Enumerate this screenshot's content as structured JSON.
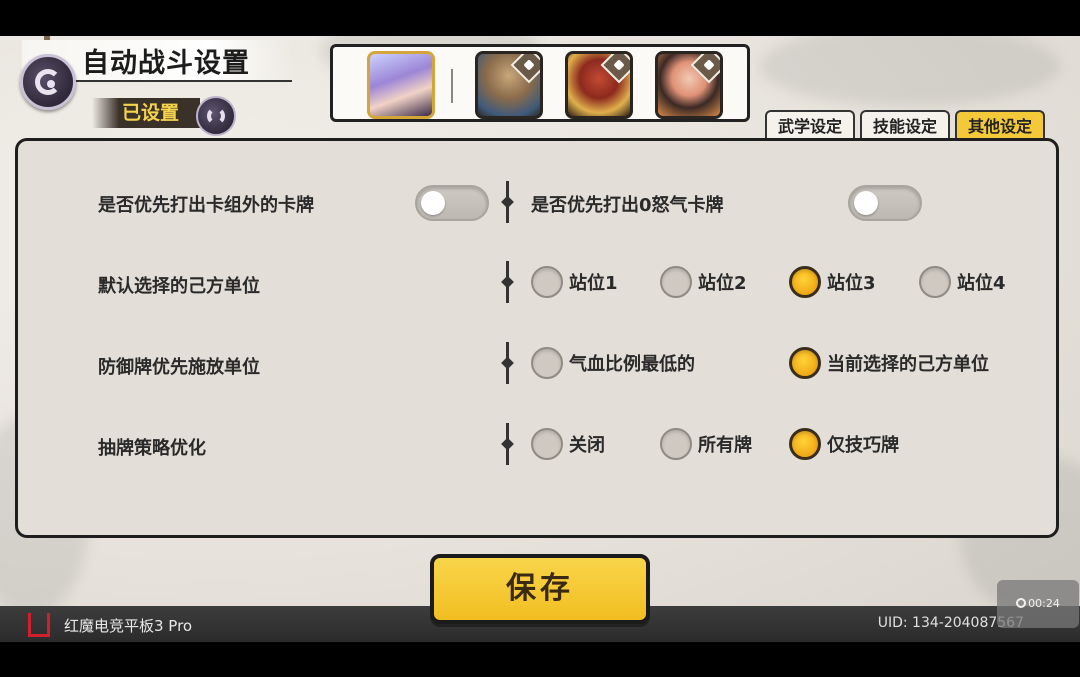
{
  "header": {
    "title": "自动战斗设置",
    "saved_badge": "已设置"
  },
  "tabs": [
    {
      "label": "武学设定",
      "active": false
    },
    {
      "label": "技能设定",
      "active": false
    },
    {
      "label": "其他设定",
      "active": true
    }
  ],
  "settings": {
    "row1": {
      "left_label": "是否优先打出卡组外的卡牌",
      "left_toggle_on": false,
      "right_label": "是否优先打出0怒气卡牌",
      "right_toggle_on": false
    },
    "row2": {
      "label": "默认选择的己方单位",
      "options": [
        "站位1",
        "站位2",
        "站位3",
        "站位4"
      ],
      "selected": "站位3"
    },
    "row3": {
      "label": "防御牌优先施放单位",
      "options": [
        "气血比例最低的",
        "当前选择的己方单位"
      ],
      "selected": "当前选择的己方单位"
    },
    "row4": {
      "label": "抽牌策略优化",
      "options": [
        "关闭",
        "所有牌",
        "仅技巧牌"
      ],
      "selected": "仅技巧牌"
    }
  },
  "save_button": "保存",
  "footer": {
    "device": "红魔电竞平板3 Pro",
    "uid": "UID:  134-204087567"
  },
  "timer": "00:24",
  "colors": {
    "accent": "#f3c93a",
    "panel": "#e3ded8",
    "selected_radio": "#f0a915"
  }
}
